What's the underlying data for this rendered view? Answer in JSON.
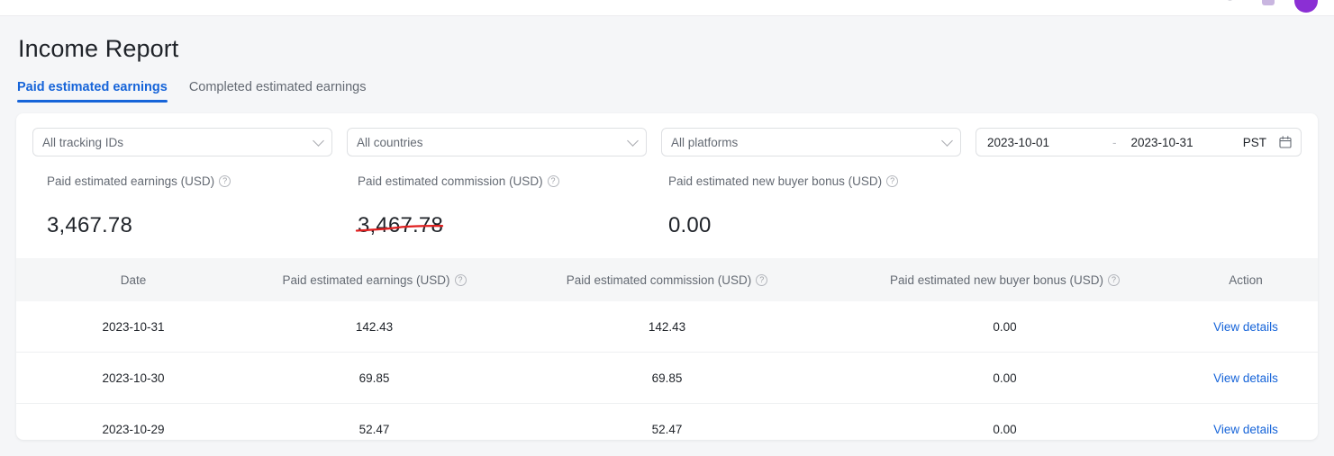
{
  "topbar": {
    "avatar_color": "#8b2fd4",
    "bell_icon": "bell-icon",
    "avatar_icon": "user-avatar"
  },
  "header": {
    "title": "Income Report"
  },
  "tabs": [
    {
      "label": "Paid estimated earnings",
      "active": true
    },
    {
      "label": "Completed estimated earnings",
      "active": false
    }
  ],
  "filters": {
    "tracking_ids": {
      "value": "All tracking IDs"
    },
    "countries": {
      "value": "All countries"
    },
    "platforms": {
      "value": "All platforms"
    },
    "date_range": {
      "start": "2023-10-01",
      "separator": "-",
      "end": "2023-10-31",
      "timezone": "PST"
    }
  },
  "metrics": [
    {
      "label": "Paid estimated earnings (USD)",
      "value": "3,467.78",
      "annotated": false
    },
    {
      "label": "Paid estimated commission (USD)",
      "value": "3,467.78",
      "annotated": true
    },
    {
      "label": "Paid estimated new buyer bonus (USD)",
      "value": "0.00",
      "annotated": false
    }
  ],
  "table": {
    "columns": [
      {
        "label": "Date",
        "help": false
      },
      {
        "label": "Paid estimated earnings (USD)",
        "help": true
      },
      {
        "label": "Paid estimated commission (USD)",
        "help": true
      },
      {
        "label": "Paid estimated new buyer bonus (USD)",
        "help": true
      },
      {
        "label": "Action",
        "help": false
      }
    ],
    "rows": [
      {
        "date": "2023-10-31",
        "earnings": "142.43",
        "commission": "142.43",
        "bonus": "0.00",
        "action": "View details"
      },
      {
        "date": "2023-10-30",
        "earnings": "69.85",
        "commission": "69.85",
        "bonus": "0.00",
        "action": "View details"
      },
      {
        "date": "2023-10-29",
        "earnings": "52.47",
        "commission": "52.47",
        "bonus": "0.00",
        "action": "View details"
      }
    ]
  },
  "colors": {
    "accent": "#1664d9",
    "annotation": "#e02020",
    "page_bg": "#f5f6f8",
    "text": "#1f2329",
    "muted": "#646a73"
  }
}
